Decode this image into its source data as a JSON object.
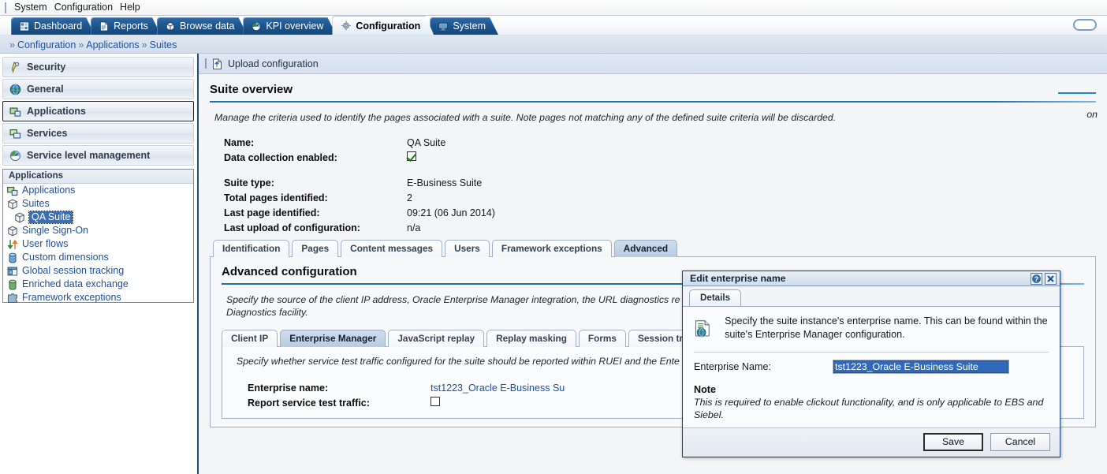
{
  "menubar": {
    "items": [
      {
        "label": "System"
      },
      {
        "label": "Configuration"
      },
      {
        "label": "Help"
      }
    ]
  },
  "main_tabs": [
    {
      "label": "Dashboard",
      "icon": "dashboard-icon",
      "active": false
    },
    {
      "label": "Reports",
      "icon": "report-icon",
      "active": false
    },
    {
      "label": "Browse data",
      "icon": "cube-icon",
      "active": false
    },
    {
      "label": "KPI overview",
      "icon": "gauge-icon",
      "active": false
    },
    {
      "label": "Configuration",
      "icon": "gear-icon",
      "active": true
    },
    {
      "label": "System",
      "icon": "monitor-icon",
      "active": false
    }
  ],
  "breadcrumb": {
    "separator": "»",
    "items": [
      "Configuration",
      "Applications",
      "Suites"
    ]
  },
  "sidebar": {
    "sections": [
      {
        "label": "Security",
        "icon": "key-icon",
        "selected": false
      },
      {
        "label": "General",
        "icon": "globe-icon",
        "selected": false
      },
      {
        "label": "Applications",
        "icon": "application-icon",
        "selected": true
      },
      {
        "label": "Services",
        "icon": "service-icon",
        "selected": false
      },
      {
        "label": "Service level management",
        "icon": "gauge-icon",
        "selected": false
      }
    ],
    "tree": {
      "header": "Applications",
      "items": [
        {
          "label": "Applications",
          "icon": "application-icon",
          "indent": false,
          "selected": false
        },
        {
          "label": "Suites",
          "icon": "cube-icon",
          "indent": false,
          "selected": false
        },
        {
          "label": "QA Suite",
          "icon": "cube-icon",
          "indent": true,
          "selected": true
        },
        {
          "label": "Single Sign-On",
          "icon": "cube-icon",
          "indent": false,
          "selected": false
        },
        {
          "label": "User flows",
          "icon": "arrows-icon",
          "indent": false,
          "selected": false
        },
        {
          "label": "Custom dimensions",
          "icon": "cylinder-icon",
          "indent": false,
          "selected": false
        },
        {
          "label": "Global session tracking",
          "icon": "window-icon",
          "indent": false,
          "selected": false
        },
        {
          "label": "Enriched data exchange",
          "icon": "cylinder-green-icon",
          "indent": false,
          "selected": false
        },
        {
          "label": "Framework exceptions",
          "icon": "puzzle-icon",
          "indent": false,
          "selected": false
        }
      ]
    }
  },
  "toolbar": {
    "upload_label": "Upload configuration",
    "upload_icon": "upload-icon"
  },
  "suite_overview": {
    "title": "Suite overview",
    "description": "Manage the criteria used to identify the pages associated with a suite. Note pages not matching any of the defined suite criteria will be discarded.",
    "fields": [
      {
        "label": "Name:",
        "value": "QA Suite",
        "type": "text",
        "warn": false
      },
      {
        "label": "Data collection enabled:",
        "value": "",
        "type": "checkbox-checked",
        "warn": false
      },
      {
        "label": "Suite type:",
        "value": "E-Business Suite",
        "type": "text",
        "warn": false
      },
      {
        "label": "Total pages identified:",
        "value": "2",
        "type": "text",
        "warn": false
      },
      {
        "label": "Last page identified:",
        "value": "09:21 (06 Jun 2014)",
        "type": "text",
        "warn": true
      },
      {
        "label": "Last upload of configuration:",
        "value": "n/a",
        "type": "text",
        "warn": false
      }
    ],
    "tabs": [
      {
        "label": "Identification",
        "active": false
      },
      {
        "label": "Pages",
        "active": false
      },
      {
        "label": "Content messages",
        "active": false
      },
      {
        "label": "Users",
        "active": false
      },
      {
        "label": "Framework exceptions",
        "active": false
      },
      {
        "label": "Advanced",
        "active": true
      }
    ]
  },
  "advanced": {
    "title": "Advanced configuration",
    "description": "Specify the source of the client IP address, Oracle Enterprise Manager integration, the URL diagnostics re",
    "description_line2": "Diagnostics facility.",
    "tabs": [
      {
        "label": "Client IP",
        "active": false
      },
      {
        "label": "Enterprise Manager",
        "active": true
      },
      {
        "label": "JavaScript replay",
        "active": false
      },
      {
        "label": "Replay masking",
        "active": false
      },
      {
        "label": "Forms",
        "active": false
      },
      {
        "label": "Session tracking",
        "active": false
      }
    ],
    "panel_description": "Specify whether service test traffic configured for the suite should be reported within RUEI and the Ente",
    "fields": [
      {
        "label": "Enterprise name:",
        "value": "tst1223_Oracle E-Business Su",
        "type": "link"
      },
      {
        "label": "Report service test traffic:",
        "value": "",
        "type": "checkbox-unchecked"
      }
    ],
    "behind_word": "on"
  },
  "dialog": {
    "title": "Edit enterprise name",
    "help_icon": "help-icon",
    "close_icon": "close-icon",
    "tabs": [
      {
        "label": "Details",
        "active": true
      }
    ],
    "intro_icon": "document-globe-icon",
    "intro_text": "Specify the suite instance's enterprise name. This can be found within the suite's Enterprise Manager configuration.",
    "field_label": "Enterprise Name:",
    "field_value": "tst1223_Oracle E-Business Suite",
    "note_heading": "Note",
    "note_text": "This is required to enable clickout functionality, and is only applicable to EBS and Siebel.",
    "save_label": "Save",
    "cancel_label": "Cancel"
  },
  "colors": {
    "tab_active_bg": "#eef4fa",
    "tab_inactive_bg": "#1d5690",
    "accent_rule": "#1f6fb5",
    "link": "#1d4f9c",
    "selection": "#3c6eb4"
  }
}
